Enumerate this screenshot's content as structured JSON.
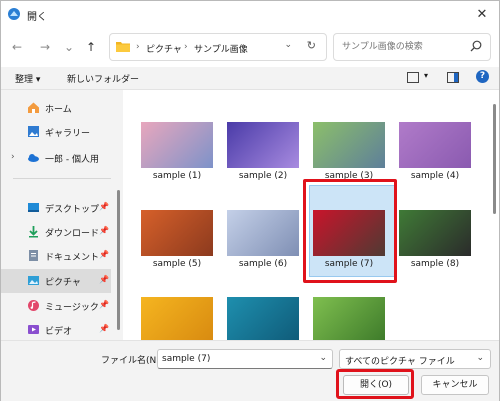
{
  "window": {
    "title": "開く",
    "close_glyph": "✕"
  },
  "nav": {
    "back_glyph": "←",
    "forward_glyph": "→",
    "recent_glyph": "⌄",
    "up_glyph": "↑",
    "breadcrumb": [
      "ピクチャ",
      "サンプル画像"
    ],
    "sep": "›",
    "dropdown_glyph": "⌄",
    "refresh_glyph": "↻"
  },
  "search": {
    "placeholder": "サンプル画像の検索"
  },
  "commands": {
    "organize": "整理 ▾",
    "new_folder": "新しいフォルダー",
    "view_dd": "▾",
    "help": "?"
  },
  "sidebar": {
    "items": [
      {
        "label": "ホーム",
        "icon": "home-icon"
      },
      {
        "label": "ギャラリー",
        "icon": "gallery-icon"
      },
      {
        "label": "一郎 - 個人用",
        "icon": "onedrive-icon",
        "expander": "›"
      },
      {
        "label": "デスクトップ",
        "icon": "desktop-icon",
        "pin": "📌"
      },
      {
        "label": "ダウンロード",
        "icon": "download-icon",
        "pin": "📌"
      },
      {
        "label": "ドキュメント",
        "icon": "documents-icon",
        "pin": "📌"
      },
      {
        "label": "ピクチャ",
        "icon": "pictures-icon",
        "pin": "📌"
      },
      {
        "label": "ミュージック",
        "icon": "music-icon",
        "pin": "📌"
      },
      {
        "label": "ビデオ",
        "icon": "video-icon",
        "pin": "📌"
      }
    ]
  },
  "files": [
    {
      "name": "sample (1)",
      "c1": "#e8a7bd",
      "c2": "#7d92c9"
    },
    {
      "name": "sample (2)",
      "c1": "#4a3ba8",
      "c2": "#a88be0"
    },
    {
      "name": "sample (3)",
      "c1": "#8cbf6a",
      "c2": "#5e7f9a"
    },
    {
      "name": "sample (4)",
      "c1": "#b07bc9",
      "c2": "#8a5ab0"
    },
    {
      "name": "sample (5)",
      "c1": "#d6602a",
      "c2": "#8c3a1e"
    },
    {
      "name": "sample (6)",
      "c1": "#c4d0e8",
      "c2": "#7f8fb4"
    },
    {
      "name": "sample (7)",
      "c1": "#c9142b",
      "c2": "#4f3a33"
    },
    {
      "name": "sample (8)",
      "c1": "#3f7a36",
      "c2": "#2b2b2b"
    },
    {
      "name": "",
      "c1": "#f5b520",
      "c2": "#d88a10"
    },
    {
      "name": "",
      "c1": "#1e8fae",
      "c2": "#0f5a78"
    },
    {
      "name": "",
      "c1": "#7fbf4f",
      "c2": "#3d7a2a"
    }
  ],
  "bottom": {
    "filename_label": "ファイル名(N):",
    "filename_value": "sample (7)",
    "filetype_value": "すべてのピクチャ ファイル",
    "dd_glyph": "⌄",
    "open_label": "開く(O)",
    "cancel_label": "キャンセル"
  },
  "colors": {
    "accent": "#1f66c1",
    "highlight": "#e0121b"
  }
}
